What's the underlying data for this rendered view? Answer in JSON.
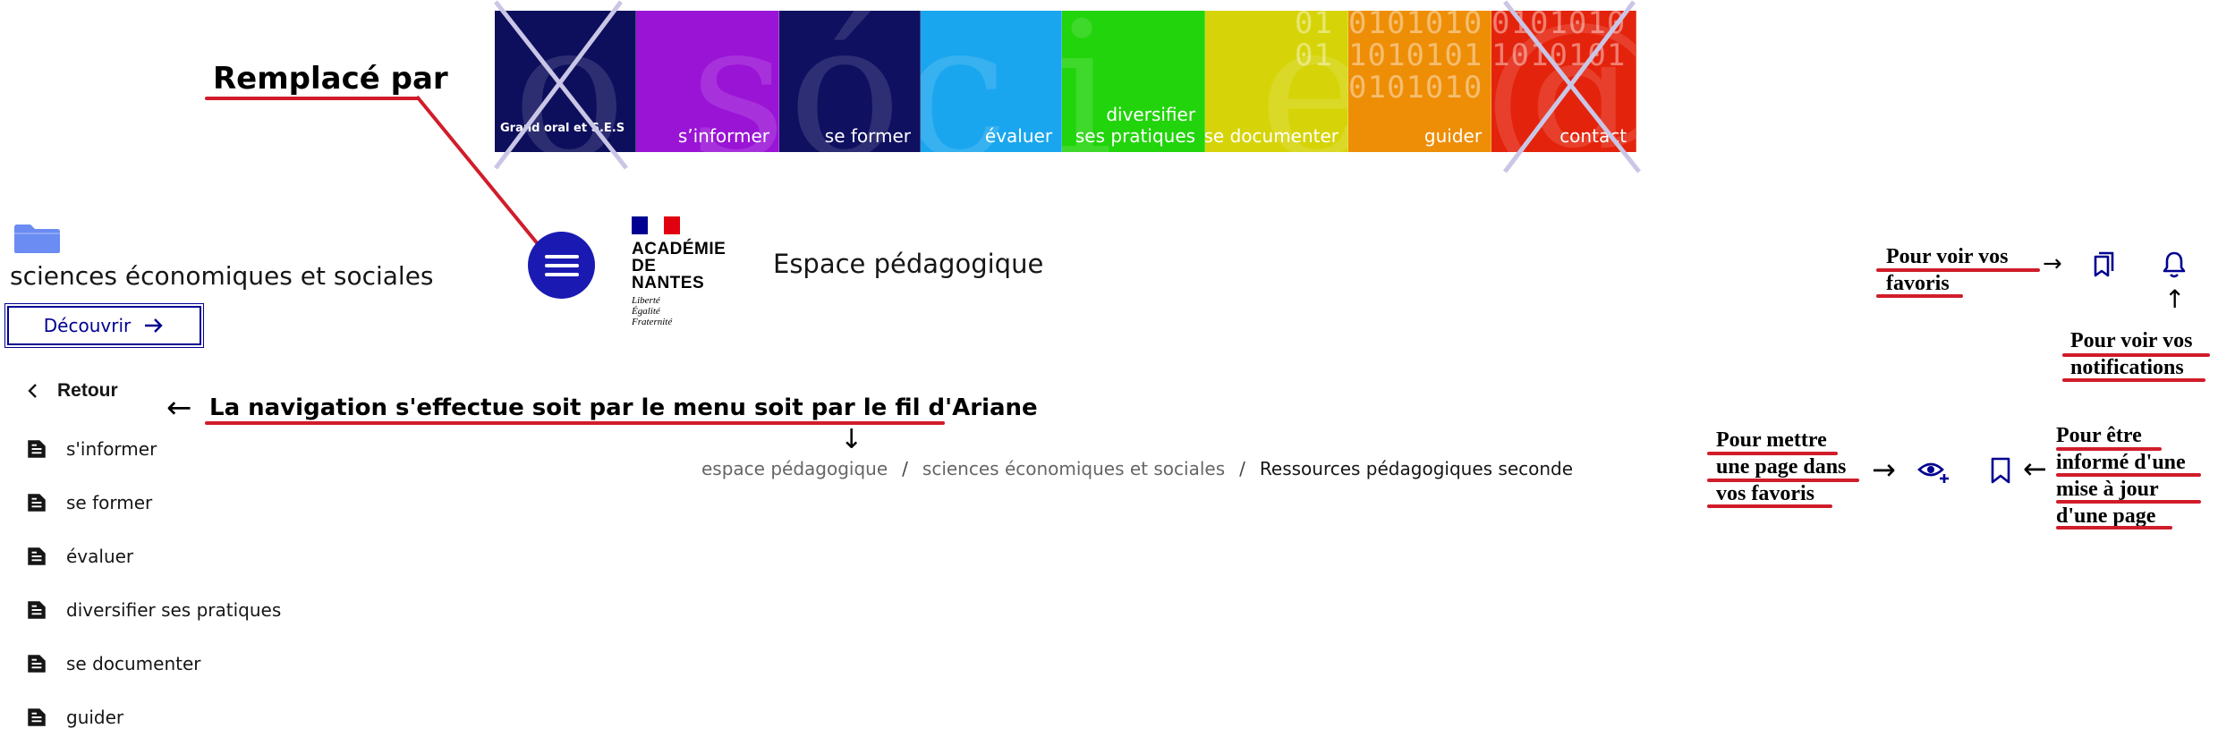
{
  "banner": {
    "tiles": [
      {
        "label": "Grand oral et S.E.S",
        "color": "#0e0f5c",
        "crossed": true
      },
      {
        "label": "s’informer",
        "color": "#9a14d6",
        "crossed": false
      },
      {
        "label": "se former",
        "color": "#0f1060",
        "crossed": false
      },
      {
        "label": "évaluer",
        "color": "#1aa6ee",
        "crossed": false
      },
      {
        "label_line1": "diversifier",
        "label_line2": "ses pratiques",
        "color": "#22d40b",
        "crossed": false
      },
      {
        "label": "se documenter",
        "color": "#d6d408",
        "crossed": false
      },
      {
        "label": "guider",
        "color": "#ee8e06",
        "crossed": false
      },
      {
        "label": "contact",
        "color": "#e4230c",
        "crossed": true
      }
    ]
  },
  "annotations": {
    "replaced_by": "Remplacé par",
    "navigation_note": "La navigation s'effectue soit par le menu soit par le fil d'Ariane",
    "favorites_view": {
      "line1": "Pour voir vos",
      "line2": "favoris"
    },
    "notifications_view": {
      "line1": "Pour voir vos",
      "line2": "notifications"
    },
    "add_favorite": {
      "line1": "Pour mettre",
      "line2": "une page dans",
      "line3": "vos favoris"
    },
    "follow_page": {
      "line1": "Pour être",
      "line2": "informé d'une",
      "line3": "mise à jour",
      "line4": "d'une page"
    },
    "arrow_right": "→",
    "arrow_left": "←",
    "arrow_down": "↓",
    "arrow_up": "↑",
    "annotation_color": "#d11c2a"
  },
  "header": {
    "rubric_title": "sciences économiques et sociales",
    "discover_button": "Découvrir",
    "logo": {
      "line1": "ACADÉMIE",
      "line2": "DE NANTES",
      "motto1": "Liberté",
      "motto2": "Égalité",
      "motto3": "Fraternité"
    },
    "site_name": "Espace pédagogique",
    "accent_color": "#000091"
  },
  "sidebar": {
    "back_label": "Retour",
    "items": [
      {
        "label": "s'informer"
      },
      {
        "label": "se former"
      },
      {
        "label": "évaluer"
      },
      {
        "label": "diversifier ses pratiques"
      },
      {
        "label": "se documenter"
      },
      {
        "label": "guider"
      }
    ]
  },
  "breadcrumb": {
    "items": [
      "espace pédagogique",
      "sciences économiques et sociales"
    ],
    "current": "Ressources pédagogiques seconde",
    "separator": "/"
  }
}
